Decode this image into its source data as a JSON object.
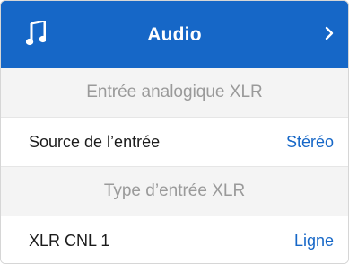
{
  "header": {
    "icon": "music-note-icon",
    "title": "Audio",
    "chevron_icon": "chevron-right-icon",
    "background_color": "#1667c7"
  },
  "sections": [
    {
      "title": "Entrée analogique XLR",
      "setting": {
        "label": "Source de l’entrée",
        "value": "Stéréo"
      }
    },
    {
      "title": "Type d’entrée XLR",
      "setting": {
        "label": "XLR CNL 1",
        "value": "Ligne"
      }
    }
  ],
  "colors": {
    "accent": "#1667c7",
    "section_background": "#f4f4f4",
    "section_text": "#9a9a9a"
  }
}
